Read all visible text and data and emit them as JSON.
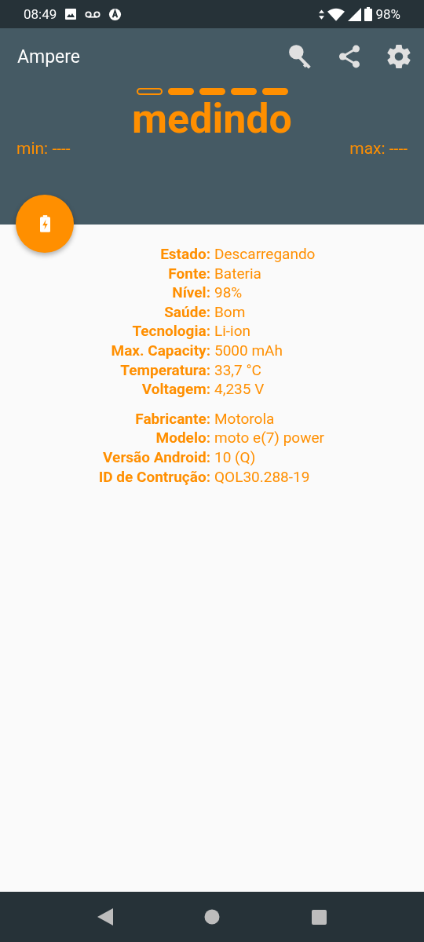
{
  "status_bar": {
    "time": "08:49",
    "battery": "98%"
  },
  "app_bar": {
    "title": "Ampere"
  },
  "meter": {
    "segments": [
      {
        "filled": false
      },
      {
        "filled": true
      },
      {
        "filled": true
      },
      {
        "filled": true
      },
      {
        "filled": true
      }
    ],
    "status": "medindo",
    "min": "min: ----",
    "max": "max: ----"
  },
  "info_groups": [
    {
      "rows": [
        {
          "label": "Estado:",
          "value": "Descarregando"
        },
        {
          "label": "Fonte:",
          "value": "Bateria"
        },
        {
          "label": "Nível:",
          "value": "98%"
        },
        {
          "label": "Saúde:",
          "value": "Bom"
        },
        {
          "label": "Tecnologia:",
          "value": "Li-ion"
        },
        {
          "label": "Max. Capacity:",
          "value": "5000 mAh"
        },
        {
          "label": "Temperatura:",
          "value": "33,7 °C"
        },
        {
          "label": "Voltagem:",
          "value": "4,235 V"
        }
      ]
    },
    {
      "rows": [
        {
          "label": "Fabricante:",
          "value": "Motorola"
        },
        {
          "label": "Modelo:",
          "value": "moto e(7) power"
        },
        {
          "label": "Versão Android:",
          "value": "10 (Q)"
        },
        {
          "label": "ID de Contrução:",
          "value": "QOL30.288-19"
        }
      ]
    }
  ]
}
